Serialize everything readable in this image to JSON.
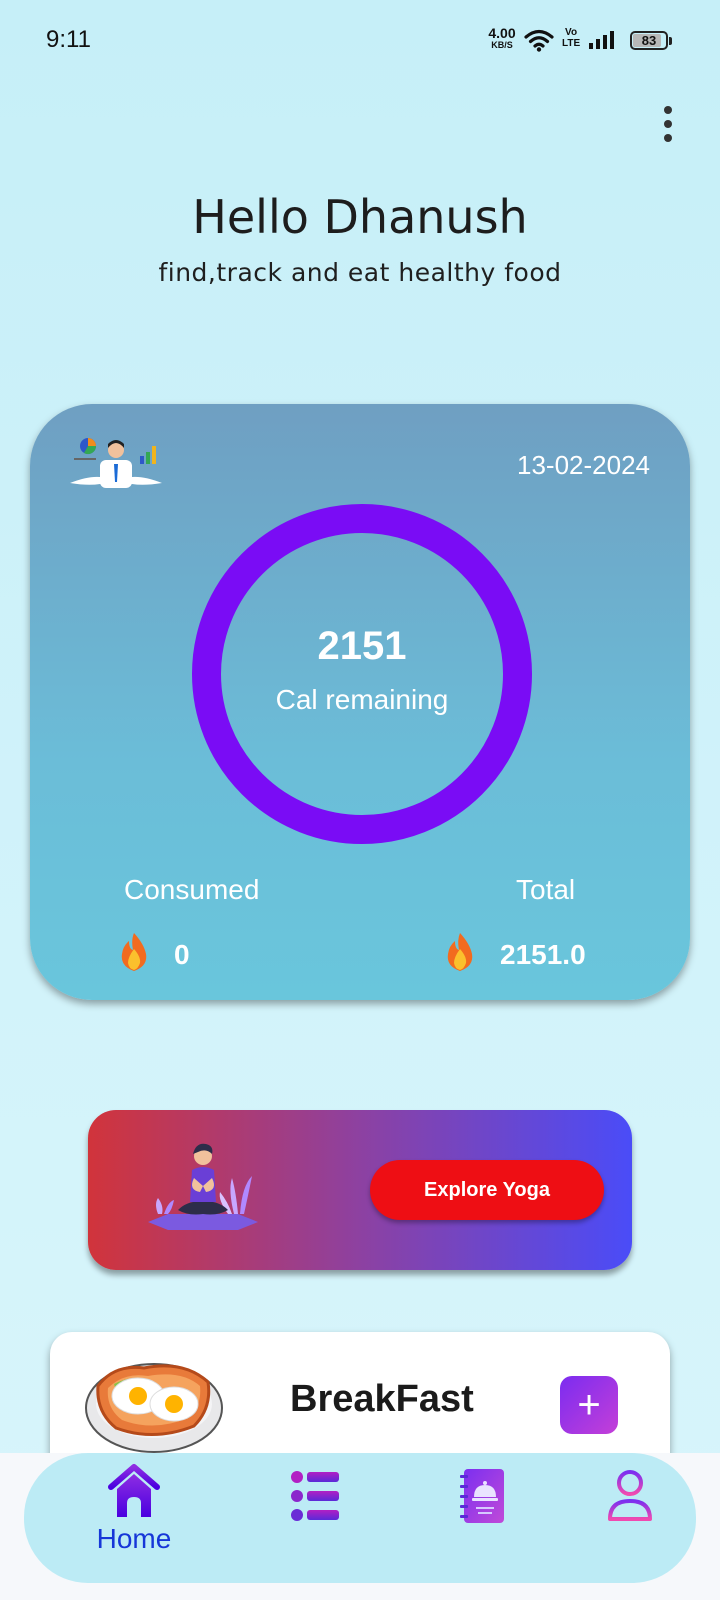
{
  "status_bar": {
    "time": "9:11",
    "net_speed_value": "4.00",
    "net_speed_unit": "KB/S",
    "volte_top": "Vo",
    "volte_bottom": "LTE",
    "battery_level": "83"
  },
  "header": {
    "greeting": "Hello Dhanush",
    "subtitle": "find,track and eat healthy food"
  },
  "calorie_card": {
    "date": "13-02-2024",
    "remaining_value": "2151",
    "remaining_label": "Cal remaining",
    "consumed_label": "Consumed",
    "consumed_value": "0",
    "total_label": "Total",
    "total_value": "2151.0",
    "ring_color": "#7a0cf5"
  },
  "yoga_banner": {
    "button_label": "Explore Yoga"
  },
  "meal_card": {
    "title": "BreakFast",
    "add_label": "+"
  },
  "bottom_nav": {
    "items": [
      {
        "icon": "home-icon",
        "label": "Home",
        "active": true
      },
      {
        "icon": "list-icon"
      },
      {
        "icon": "recipe-book-icon"
      },
      {
        "icon": "profile-icon"
      }
    ]
  },
  "colors": {
    "accent_purple": "#7a0cf5",
    "explore_red": "#ee0e14",
    "nav_active_blue": "#1636d8"
  }
}
